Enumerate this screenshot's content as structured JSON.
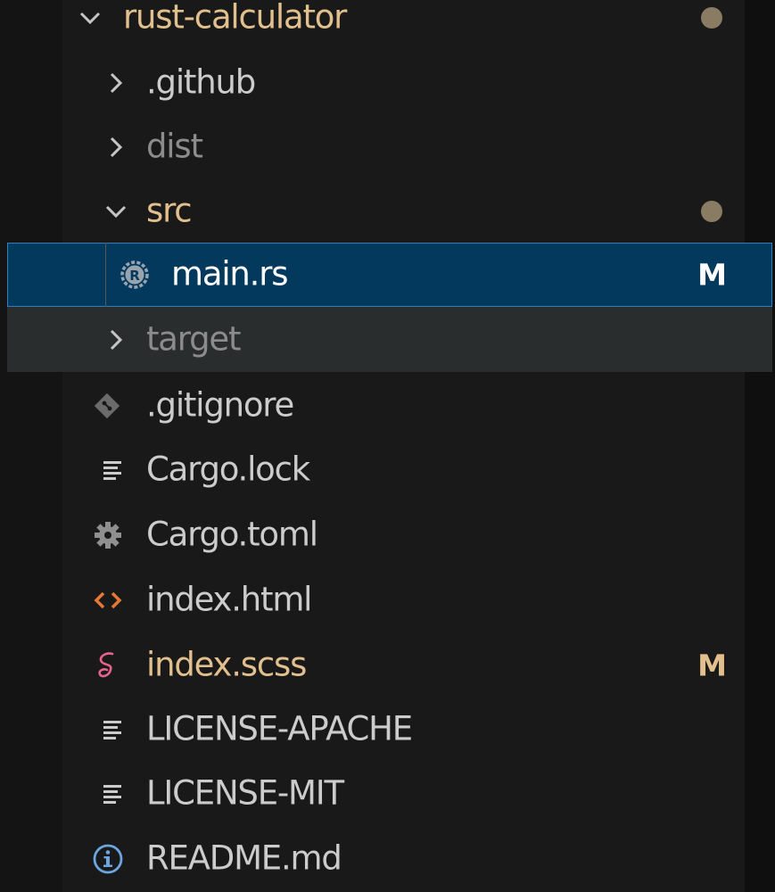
{
  "explorer": {
    "root": {
      "label": "rust-calculator",
      "color": "#e2c08d",
      "icon": "chevron-down-icon"
    },
    "items": [
      {
        "label": ".github",
        "type": "folder",
        "icon": "chevron-right-icon",
        "color": "#cccccc"
      },
      {
        "label": "dist",
        "type": "folder",
        "icon": "chevron-right-icon",
        "color": "#8c8c8c"
      },
      {
        "label": "src",
        "type": "folder-open",
        "icon": "chevron-down-icon",
        "color": "#e2c08d"
      },
      {
        "label": "main.rs",
        "type": "file",
        "icon": "rust-icon",
        "color": "#ffffff",
        "badge": "M",
        "selected": true
      },
      {
        "label": "target",
        "type": "folder",
        "icon": "chevron-right-icon",
        "color": "#8c8c8c"
      },
      {
        "label": ".gitignore",
        "type": "file",
        "icon": "git-icon",
        "color": "#cccccc"
      },
      {
        "label": "Cargo.lock",
        "type": "file",
        "icon": "text-lines-icon",
        "color": "#cccccc"
      },
      {
        "label": "Cargo.toml",
        "type": "file",
        "icon": "gear-icon",
        "color": "#cccccc"
      },
      {
        "label": "index.html",
        "type": "file",
        "icon": "html-icon",
        "color": "#cccccc"
      },
      {
        "label": "index.scss",
        "type": "file",
        "icon": "sass-icon",
        "color": "#e2c08d",
        "badge": "M"
      },
      {
        "label": "LICENSE-APACHE",
        "type": "file",
        "icon": "text-lines-icon",
        "color": "#cccccc"
      },
      {
        "label": "LICENSE-MIT",
        "type": "file",
        "icon": "text-lines-icon",
        "color": "#cccccc"
      },
      {
        "label": "README.md",
        "type": "file",
        "icon": "info-icon",
        "color": "#cccccc"
      }
    ],
    "colors": {
      "modified": "#e2c08d",
      "selected_bg": "#04395e",
      "selected_border": "#2d7fbd",
      "badge_selected": "#ffffff",
      "sass_icon": "#e8648e",
      "html_icon": "#e37933",
      "info_icon": "#6ca6e0",
      "git_icon": "#6b6b6b",
      "modified_dot": "#8a7c62"
    }
  }
}
